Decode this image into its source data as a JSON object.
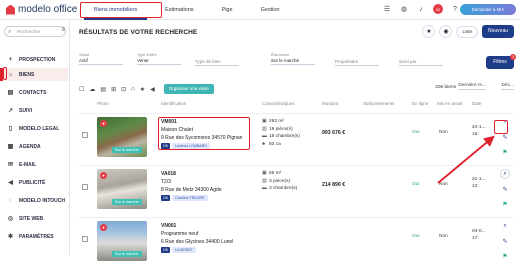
{
  "topbar": {
    "logo": "modelo office",
    "tabs": [
      "Biens immobiliers",
      "Estimations",
      "Pige",
      "Gestion"
    ],
    "active_tab": "Biens immobiliers",
    "mia_button": "Demander à MIA",
    "notification_count": "20"
  },
  "sidebar": {
    "search_placeholder": "Rechercher",
    "items": [
      "PROSPECTION",
      "BIENS",
      "CONTACTS",
      "SUIVI",
      "MODELO LEGAL",
      "AGENDA",
      "E-MAIL",
      "PUBLICITÉ",
      "MODELO INTOUCH",
      "SITE WEB",
      "PARAMÈTRES"
    ]
  },
  "main": {
    "title": "RÉSULTATS DE VOTRE RECHERCHE",
    "view_select": "Liste",
    "new_button": "Nouveau",
    "filters": [
      {
        "label": "Statut",
        "value": "Actif"
      },
      {
        "label": "Type d'offre",
        "value": "Vente"
      },
      {
        "label": "",
        "value": "Type de bien"
      },
      {
        "label": "État actuel",
        "value": "Sur le marché"
      },
      {
        "label": "",
        "value": "Propriétaire"
      },
      {
        "label": "",
        "value": "Suivi par"
      }
    ],
    "filters_button": "Filtres",
    "filters_badge": "3",
    "organize_button": "Organiser une visite",
    "result_count": "206 biens",
    "sort_field": "Dernière m...",
    "sort_order": "Déc..."
  },
  "columns": [
    "Photo",
    "Identification",
    "Caractéristiques",
    "Montant",
    "Stationnements",
    "En ligne",
    "Mis en avant",
    "Date"
  ],
  "rows": [
    {
      "ref": "VM001",
      "name": "Maison Chalet",
      "address": "9 Rue des Sycomores 34570 Pignan",
      "status_chip": "OK",
      "agent": "Lorenzo LOMBARD",
      "surface": "292 m²",
      "rooms": "19 pièce(s)",
      "bedrooms": "18 chambre(s)",
      "land": "83 ca",
      "price": "993 676 €",
      "online": "Oui",
      "featured": "Non",
      "date": "24-1...",
      "date2": "15:"
    },
    {
      "ref": "VA018",
      "name": "T2/3",
      "address": "8 Rue de Metz 34300 Agde",
      "status_chip": "OK",
      "agent": "Caroline TRAORE",
      "surface": "65 m²",
      "rooms": "3 pièce(s)",
      "bedrooms": "3 chambre(s)",
      "land": "",
      "price": "214 890 €",
      "online": "Oui",
      "featured": "Non",
      "date": "21-1...",
      "date2": "12:"
    },
    {
      "ref": "VN001",
      "name": "Programme neuf",
      "address": "6 Rue des Glycines 34400 Lunel",
      "status_chip": "OK",
      "agent": "Lili BODET",
      "surface": "",
      "rooms": "",
      "bedrooms": "",
      "land": "",
      "price": "",
      "online": "Oui",
      "featured": "Non",
      "date": "04-0...",
      "date2": "17:"
    }
  ],
  "tag_label": "Sur le marché"
}
